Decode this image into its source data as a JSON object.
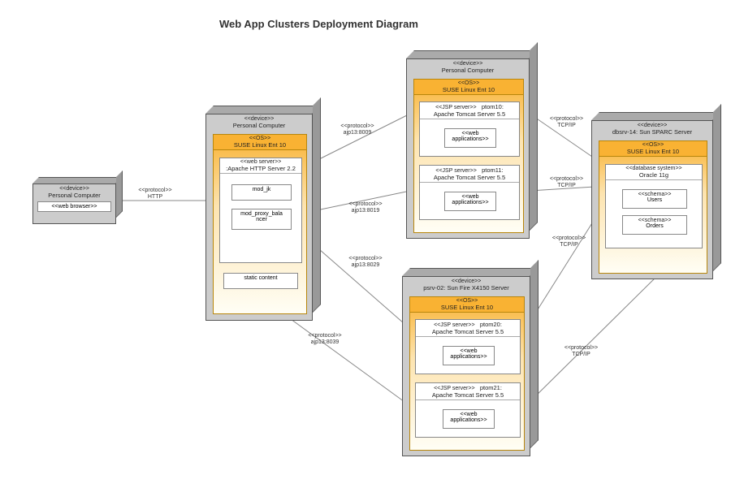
{
  "title": "Web App Clusters Deployment Diagram",
  "stereotypes": {
    "device": "<<device>>",
    "os": "<<OS>>",
    "protocol": "<<protocol>>",
    "webbrowser": "<<web browser>>",
    "webserver": "<<web server>>",
    "jspserver": "<<JSP server>>",
    "webapps": "<<web\napplications>>",
    "dbsystem": "<<database system>>",
    "schema": "<<schema>>"
  },
  "nodes": {
    "client": {
      "name": "Personal Computer"
    },
    "httpServer": {
      "name": "Personal Computer",
      "os": "SUSE Linux Ent 10",
      "server": ":Apache HTTP Server 2.2",
      "mods": [
        "mod_jk",
        "mod_proxy_bala\nncer",
        "static content"
      ]
    },
    "appServer1": {
      "name": "Personal Computer",
      "os": "SUSE Linux Ent 10",
      "jsp": [
        {
          "name": "ptom10:\nApache Tomcat Server 5.5"
        },
        {
          "name": "ptom11:\nApache Tomcat Server 5.5"
        }
      ]
    },
    "appServer2": {
      "name": "psrv-02: Sun Fire X4150 Server",
      "os": "SUSE Linux Ent 10",
      "jsp": [
        {
          "name": "ptom20:\nApache Tomcat Server 5.5"
        },
        {
          "name": "ptom21:\nApache Tomcat Server 5.5"
        }
      ]
    },
    "dbServer": {
      "name": "dbsrv-14: Sun SPARC Server",
      "os": "SUSE Linux Ent 10",
      "db": "Oracle 11g",
      "schemas": [
        "Users",
        "Orders"
      ]
    }
  },
  "connections": {
    "http": "HTTP",
    "ajp1": "ajp13:8009",
    "ajp2": "ajp13:8019",
    "ajp3": "ajp13:8029",
    "ajp4": "ajp13:8039",
    "tcpip": "TCP/IP"
  }
}
